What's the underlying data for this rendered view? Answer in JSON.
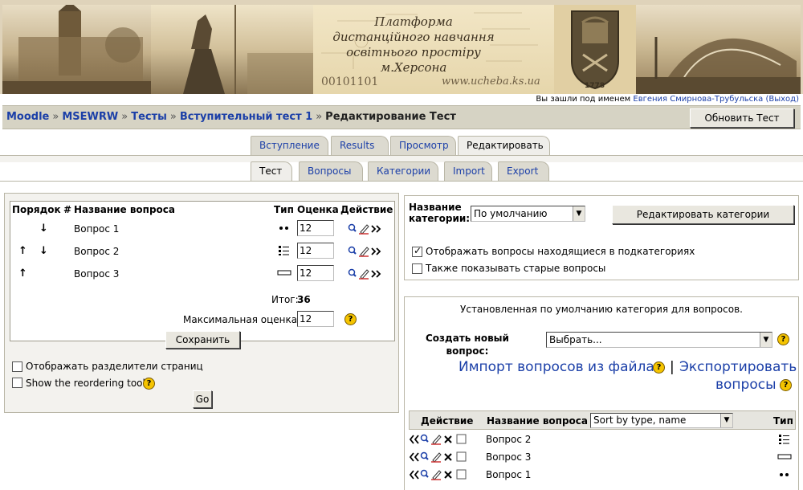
{
  "banner": {
    "title_lines": [
      "Платформа",
      "дистанційного навчання",
      "освітнього простіру",
      "м.Херсона"
    ],
    "site_url": "www.ucheba.ks.ua",
    "binary_decoration": "00101101",
    "emblem_year": "1778"
  },
  "login": {
    "prefix": "Вы зашли под именем",
    "user": "Евгения Смирнова-Трубульска",
    "logout": "(Выход)"
  },
  "breadcrumb": {
    "items": [
      "Moodle",
      "MSEWRW",
      "Тесты",
      "Вступительный тест 1"
    ],
    "separator": "»",
    "current": "Редактирование Тест"
  },
  "header": {
    "update_button": "Обновить Тест"
  },
  "tabs_row1": [
    "Вступление",
    "Results",
    "Просмотр",
    "Редактировать"
  ],
  "tabs_row2": [
    "Тест",
    "Вопросы",
    "Категории",
    "Import",
    "Export"
  ],
  "quiz": {
    "headers": {
      "order": "Порядок",
      "num": "#",
      "name": "Название вопроса",
      "type": "Тип",
      "grade": "Оценка",
      "action": "Действие"
    },
    "rows": [
      {
        "name": "Вопрос 1",
        "grade": "12",
        "type_icon": "multichoice-dots-icon"
      },
      {
        "name": "Вопрос 2",
        "grade": "12",
        "type_icon": "list-icon"
      },
      {
        "name": "Вопрос 3",
        "grade": "12",
        "type_icon": "shortanswer-box-icon"
      }
    ],
    "total_label": "Итог:",
    "total_value": "36",
    "maxgrade_label": "Максимальная оценка:",
    "maxgrade_value": "12",
    "save_button": "Сохранить",
    "show_breaks": "Отображать разделители страниц",
    "show_reorder": "Show the reordering tool",
    "go_button": "Go"
  },
  "category": {
    "label_line1": "Название",
    "label_line2": "категории:",
    "selected": "По умолчанию",
    "edit_button": "Редактировать категории",
    "show_subcats": "Отображать вопросы находящиеся в подкатегориях",
    "show_old": "Также показывать старые вопросы"
  },
  "bank": {
    "default_text": "Установленная по умолчанию категория для вопросов.",
    "create_line1": "Создать новый",
    "create_line2": "вопрос:",
    "create_select": "Выбрать...",
    "import_link": "Импорт вопросов из файла",
    "pipe": "|",
    "export_link_1": "Экспортировать",
    "export_link_2": "вопросы",
    "headers": {
      "action": "Действие",
      "name": "Название вопроса",
      "type": "Тип"
    },
    "sort_select": "Sort by type, name",
    "rows": [
      {
        "name": "Вопрос 2",
        "type_icon": "list-icon"
      },
      {
        "name": "Вопрос 3",
        "type_icon": "shortanswer-box-icon"
      },
      {
        "name": "Вопрос 1",
        "type_icon": "multichoice-dots-icon"
      }
    ]
  },
  "colors": {
    "link": "#1b3fa8",
    "panel_bg": "#f3f2ee",
    "nav_bg": "#d6d3c4",
    "help_yellow": "#f5c400"
  }
}
